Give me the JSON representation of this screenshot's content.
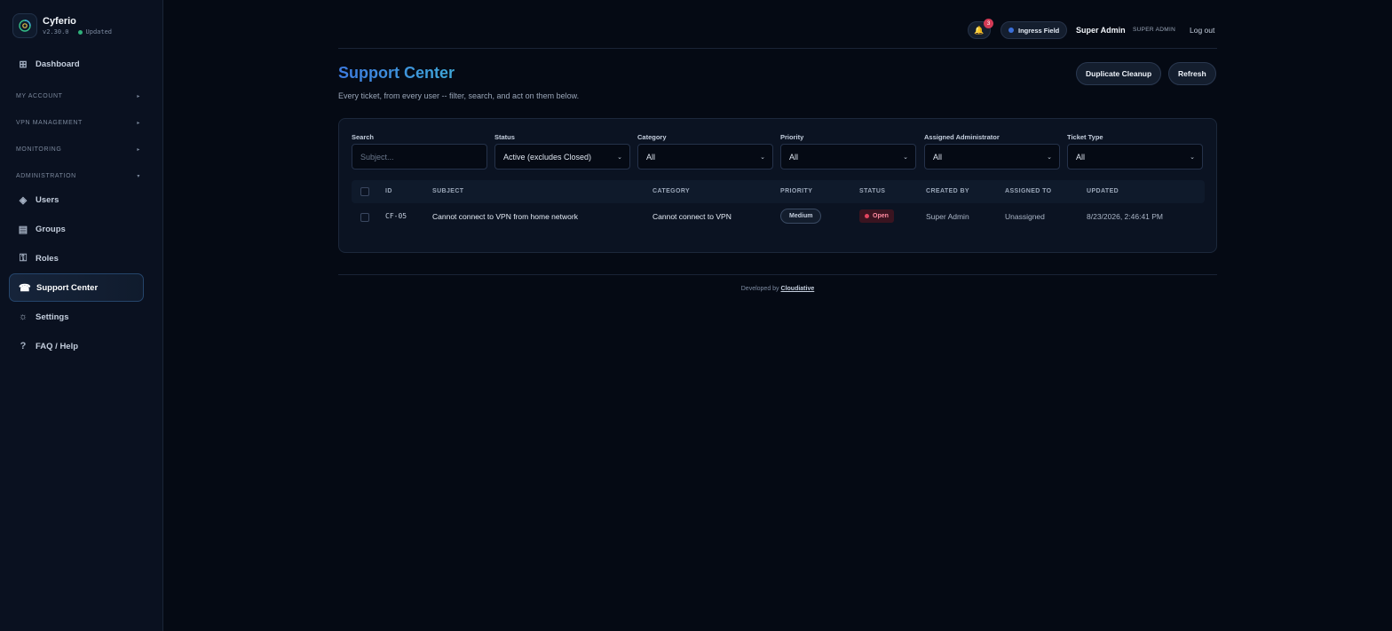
{
  "app": {
    "name": "Cyferio",
    "version": "v2.30.0",
    "status": "Updated"
  },
  "sidebar": {
    "items": [
      {
        "label": "Dashboard",
        "icon": "grid-icon"
      },
      {
        "label": "Users",
        "icon": "diamond-icon"
      },
      {
        "label": "Groups",
        "icon": "list-icon"
      },
      {
        "label": "Roles",
        "icon": "key-icon"
      },
      {
        "label": "Support Center",
        "icon": "phone-icon",
        "active": true
      },
      {
        "label": "Settings",
        "icon": "gear-icon"
      },
      {
        "label": "FAQ / Help",
        "icon": "question-icon"
      }
    ],
    "sections": [
      "MY ACCOUNT",
      "VPN MANAGEMENT",
      "MONITORING",
      "ADMINISTRATION"
    ]
  },
  "topbar": {
    "notification_count": "3",
    "location": "Ingress Field",
    "user_name": "Super Admin",
    "user_role": "SUPER ADMIN",
    "logout": "Log out"
  },
  "header": {
    "title": "Support Center",
    "subtitle": "Every ticket, from every user -- filter, search, and act on them below.",
    "duplicate_cleanup": "Duplicate Cleanup",
    "refresh": "Refresh"
  },
  "filters": {
    "search_label": "Search",
    "search_placeholder": "Subject...",
    "status_label": "Status",
    "status_value": "Active (excludes Closed)",
    "category_label": "Category",
    "category_value": "All",
    "priority_label": "Priority",
    "priority_value": "All",
    "admin_label": "Assigned Administrator",
    "admin_value": "All",
    "type_label": "Ticket Type",
    "type_value": "All"
  },
  "table": {
    "columns": [
      "ID",
      "SUBJECT",
      "CATEGORY",
      "PRIORITY",
      "STATUS",
      "CREATED BY",
      "ASSIGNED TO",
      "UPDATED"
    ],
    "rows": [
      {
        "id": "CF-05",
        "subject": "Cannot connect to VPN from home network",
        "category": "Cannot connect to VPN",
        "priority": "Medium",
        "status": "Open",
        "created_by": "Super Admin",
        "assigned_to": "Unassigned",
        "updated": "8/23/2026, 2:46:41 PM"
      }
    ]
  },
  "footer": {
    "prefix": "Developed by",
    "link": "Cloudiative"
  },
  "colors": {
    "accent": "#3d7be0",
    "background": "#050a14",
    "status_open": "#e2445f"
  }
}
